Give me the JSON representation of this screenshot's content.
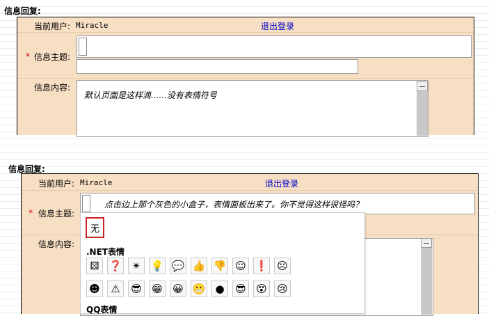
{
  "section1": {
    "title": "信息回复:",
    "current_user_label": "当前用户:",
    "current_user": "Miracle",
    "logout": "退出登录",
    "required_mark": "*",
    "subject_label": "信息主题:",
    "subject_value": "",
    "content_label": "信息内容:",
    "content_value": "默认页面是这样滴......没有表情符号"
  },
  "section2": {
    "title": "信息回复:",
    "current_user_label": "当前用户:",
    "current_user": "Miracle",
    "logout": "退出登录",
    "required_mark": "*",
    "subject_label": "信息主题:",
    "subject_value": "点击边上那个灰色的小盒子，表情面板出来了。你不觉得这样很怪吗？",
    "content_label": "信息内容:"
  },
  "emoticon_panel": {
    "none_option": "无",
    "net_group_title": ".NET表情",
    "net_row1": [
      "⚄",
      "❓",
      "✴",
      "💡",
      "💬",
      "👍",
      "👎",
      "☺",
      "❗",
      "☹"
    ],
    "net_row2": [
      "☻",
      "⚠",
      "😎",
      "😁",
      "😀",
      "😬",
      "●",
      "😎",
      "😵",
      "😢"
    ],
    "qq_group_title": "QQ表情"
  },
  "colors": {
    "panel_bg": "#f7dfc4",
    "value_bg": "#fcefe0",
    "link": "#0000cc",
    "required": "#cc0000",
    "none_border": "#cc2222"
  }
}
